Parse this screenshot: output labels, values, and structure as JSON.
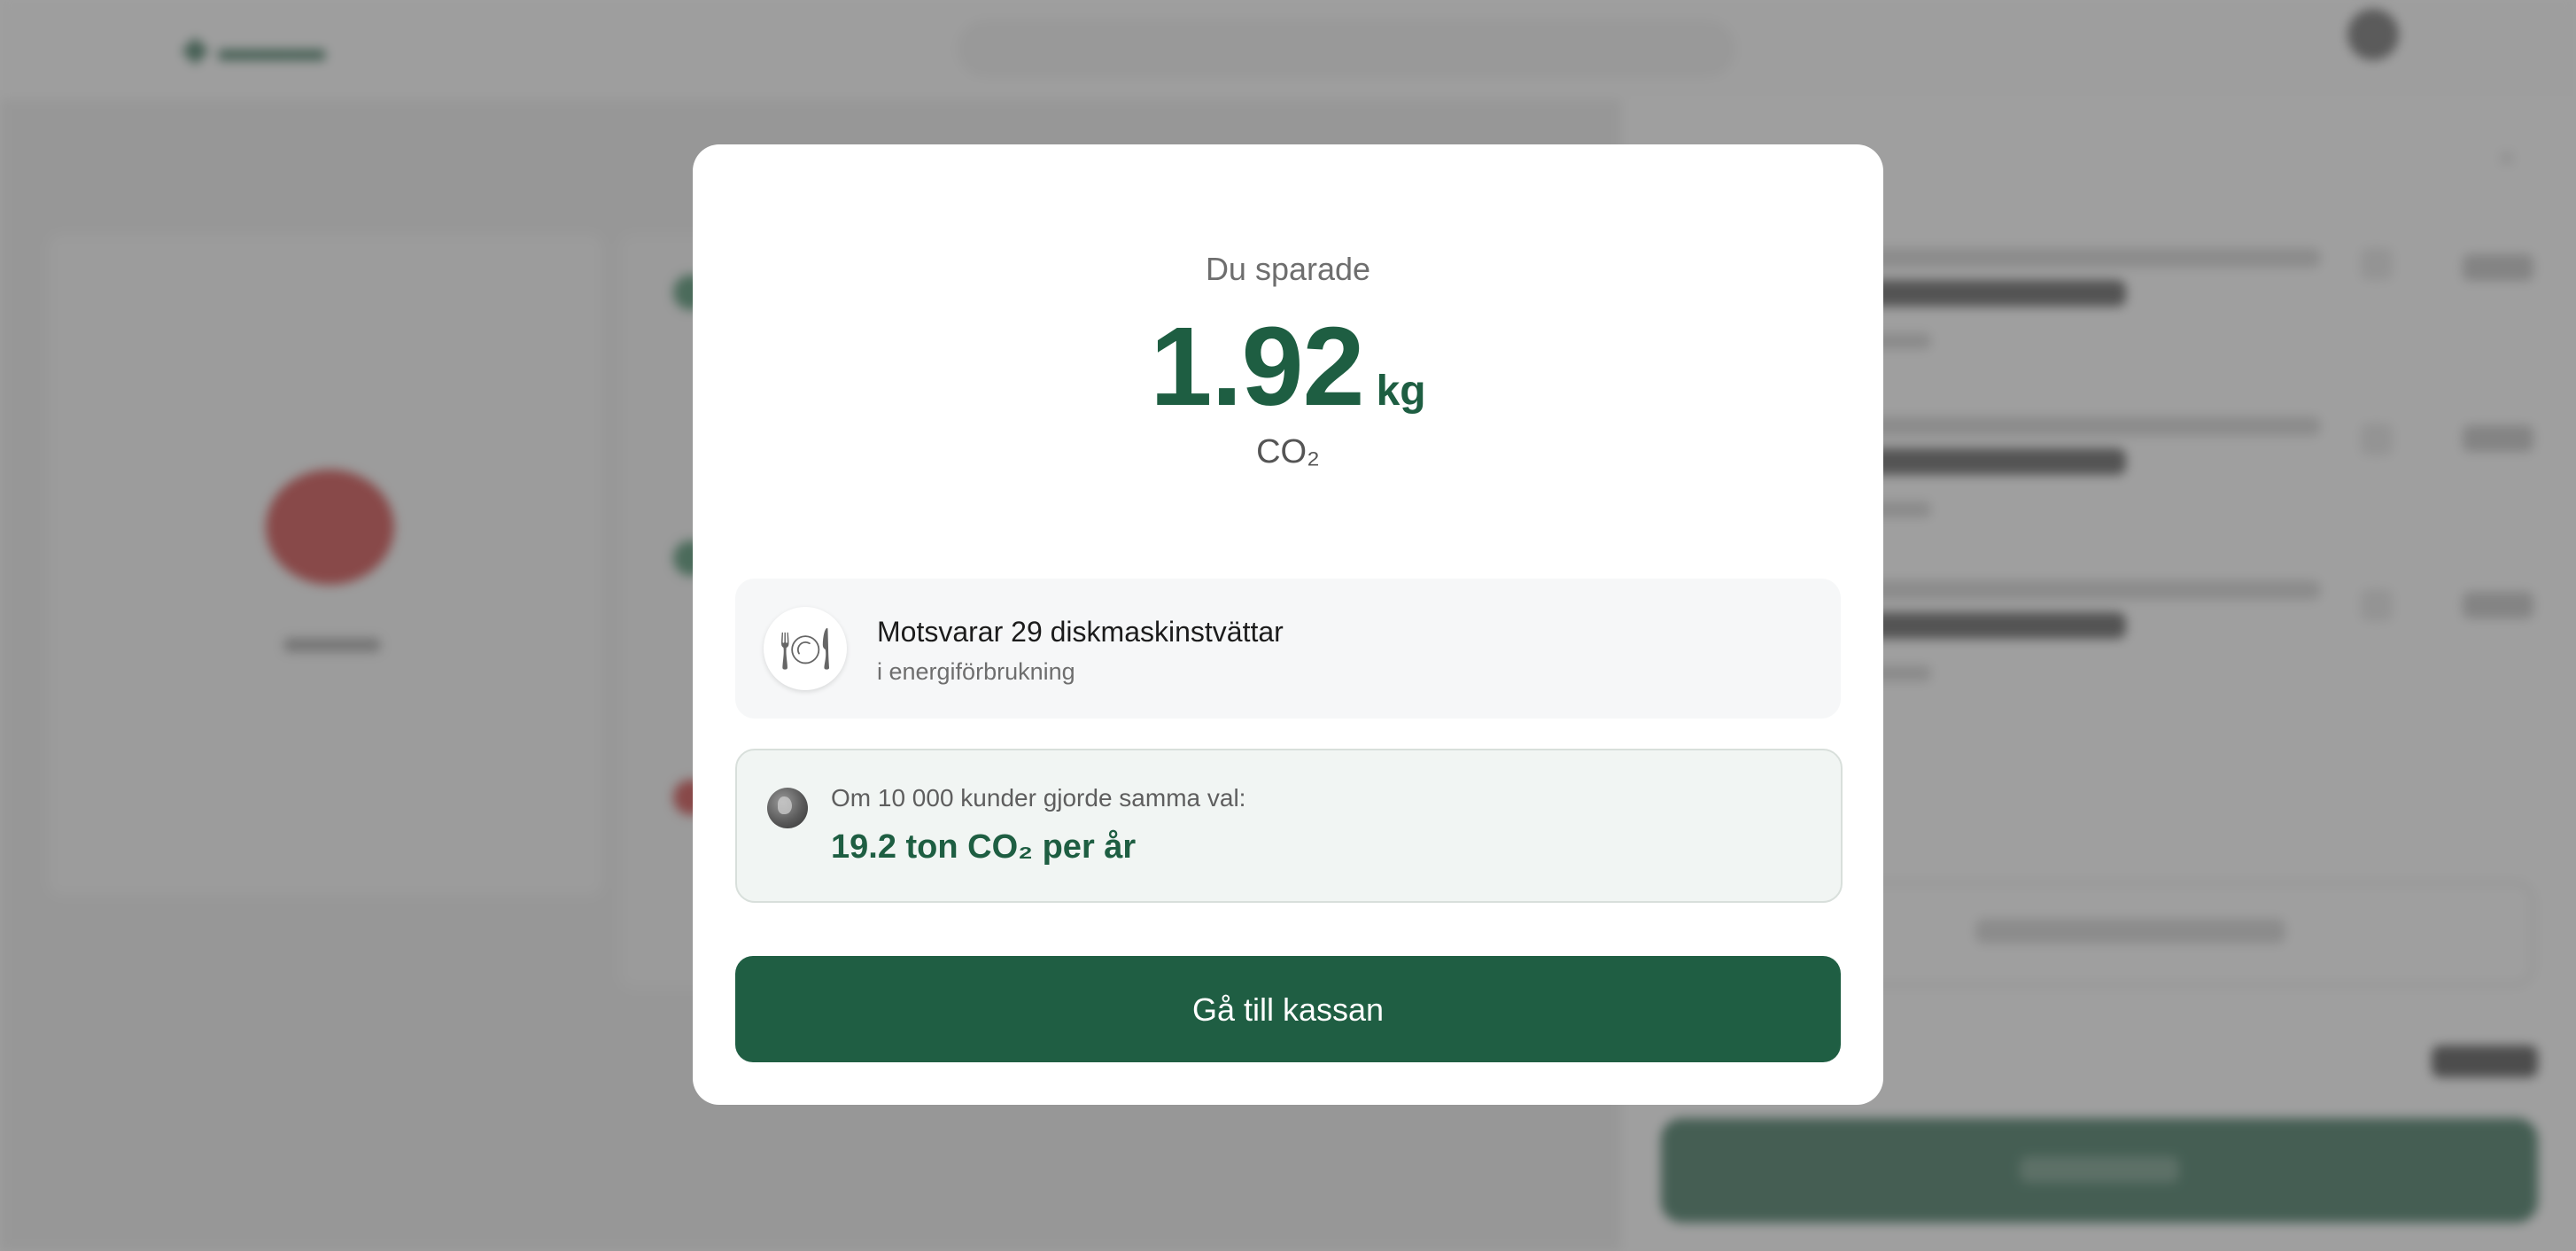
{
  "modal": {
    "label": "Du sparade",
    "value": "1.92",
    "unit": "kg",
    "gas": "CO₂",
    "equivalent": {
      "icon": "plate-cutlery-icon",
      "glyph": "🍽",
      "title": "Motsvarar 29 diskmaskinstvättar",
      "subtitle": "i energiförbrukning"
    },
    "projection": {
      "icon": "globe-icon",
      "label": "Om 10 000 kunder gjorde samma val:",
      "value": "19.2 ton CO₂ per år"
    },
    "checkout_label": "Gå till kassan"
  },
  "colors": {
    "accent": "#1e5e42",
    "button": "#1f5e43",
    "overlay": "rgba(95,95,95,0.6)"
  }
}
